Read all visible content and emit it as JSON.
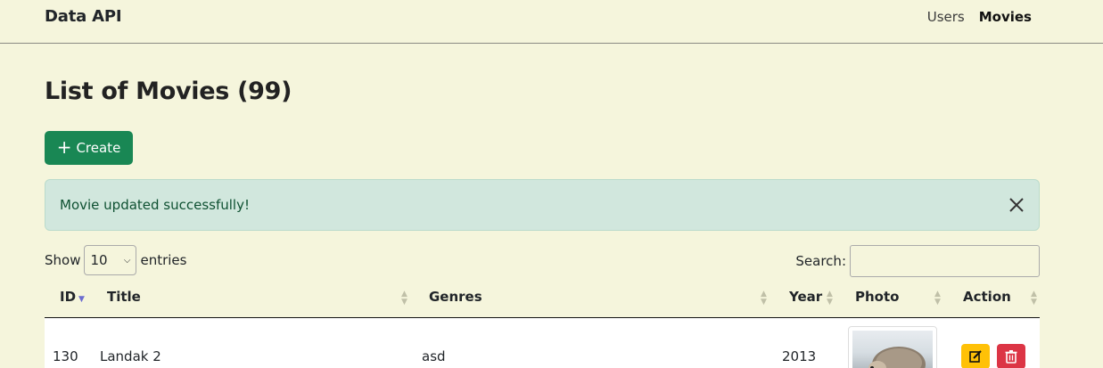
{
  "navbar": {
    "brand": "Data API",
    "links": [
      {
        "label": "Users",
        "active": false
      },
      {
        "label": "Movies",
        "active": true
      }
    ]
  },
  "page": {
    "title": "List of Movies (99)",
    "create_label": "Create"
  },
  "alert": {
    "message": "Movie updated successfully!"
  },
  "table_controls": {
    "show_label": "Show",
    "entries_value": "10",
    "entries_label": "entries",
    "search_label": "Search:",
    "search_value": ""
  },
  "table": {
    "columns": [
      "ID",
      "Title",
      "Genres",
      "Year",
      "Photo",
      "Action"
    ],
    "rows": [
      {
        "id": "130",
        "title": "Landak 2",
        "genres": "asd",
        "year": "2013"
      }
    ]
  },
  "colors": {
    "background": "#f5f5dc",
    "create_button": "#198754",
    "alert_bg": "#d1e7dd",
    "edit_button": "#ffc107",
    "delete_button": "#dc3545"
  }
}
